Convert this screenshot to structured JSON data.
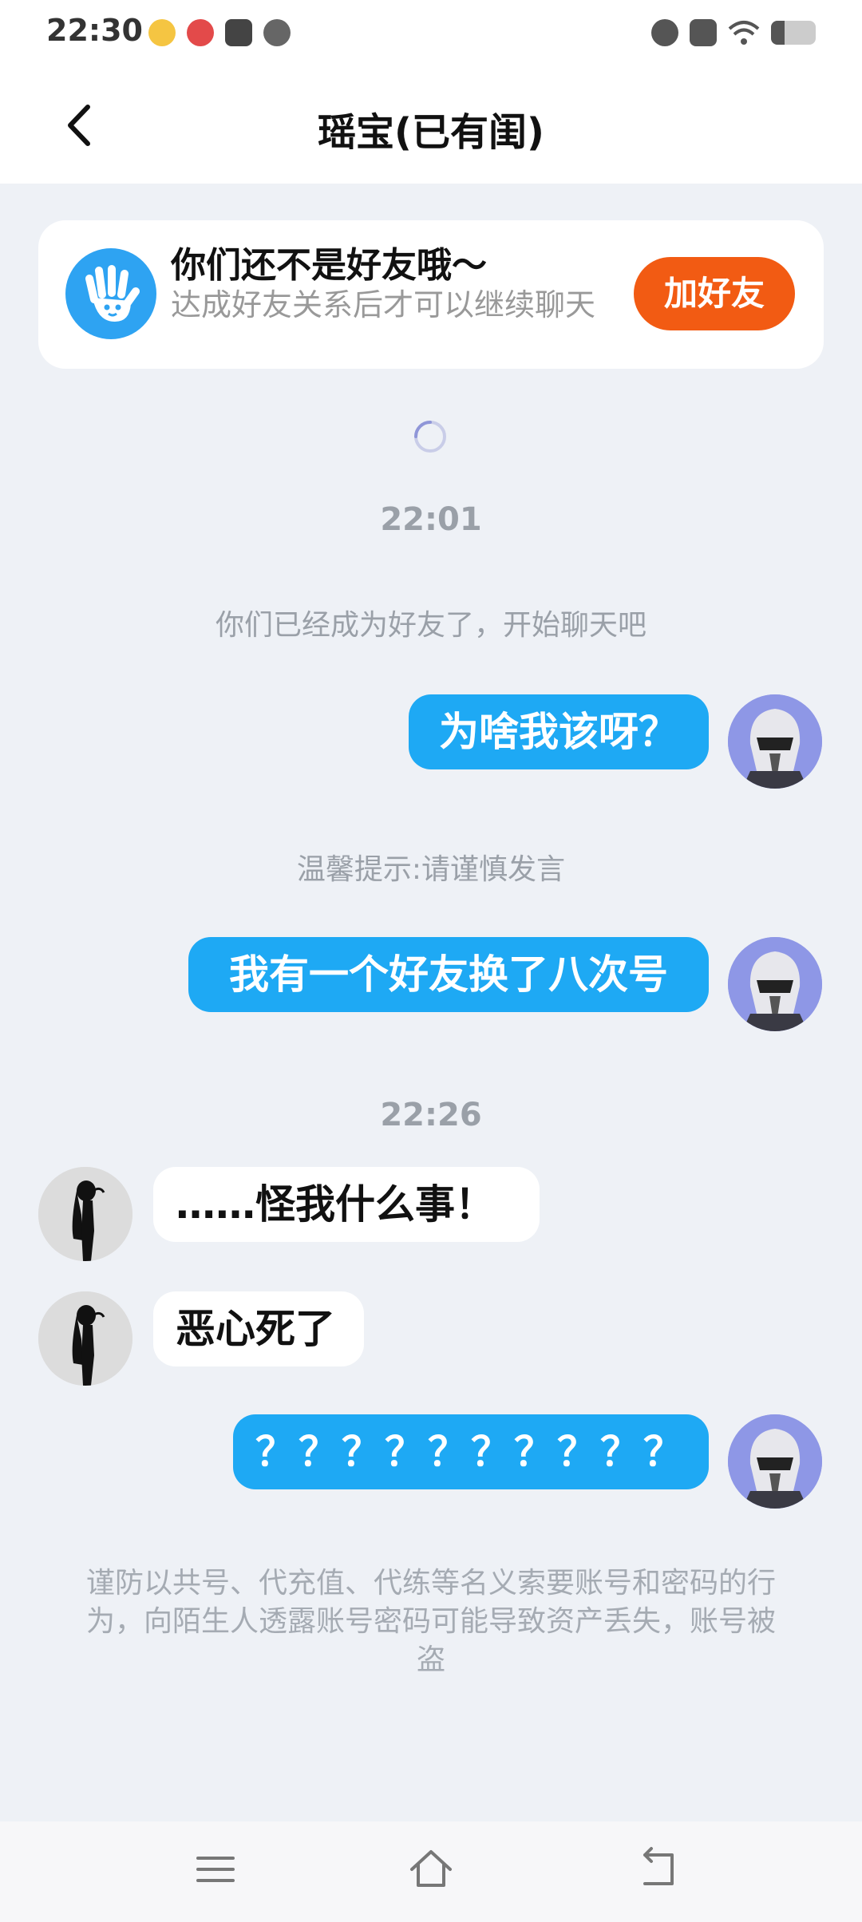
{
  "status_bar": {
    "time": "22:30",
    "left_icons": [
      "app-icon-1",
      "app-icon-2",
      "mail-icon",
      "app-icon-3"
    ],
    "right_icons": [
      "alarm-icon",
      "x-icon",
      "wifi-icon",
      "battery-icon"
    ],
    "battery_level": 0.3
  },
  "header": {
    "back_icon": "back-arrow-icon",
    "title": "瑶宝(已有闺)"
  },
  "notice": {
    "icon": "wave-hand-icon",
    "title": "你们还不是好友哦～",
    "subtitle": "达成好友关系后才可以继续聊天",
    "button_label": "加好友"
  },
  "messages": {
    "time_1": "22:01",
    "system_1": "你们已经成为好友了，开始聊天吧",
    "out_1": "为啥我该呀？",
    "system_2": "温馨提示:请谨慎发言",
    "out_2": "我有一个好友换了八次号",
    "time_2": "22:26",
    "in_1": "……怪我什么事！",
    "in_2": "恶心死了",
    "out_3": "？？？？？？？？？？"
  },
  "warning": "谨防以共号、代充值、代练等名义索要账号和密码的行为，向陌生人透露账号密码可能导致资产丢失，账号被盗",
  "nav": {
    "icons": [
      "menu-icon",
      "home-icon",
      "back-icon"
    ]
  },
  "colors": {
    "accent_blue": "#1ea9f4",
    "add_button": "#f25b13",
    "background": "#eef1f6"
  }
}
